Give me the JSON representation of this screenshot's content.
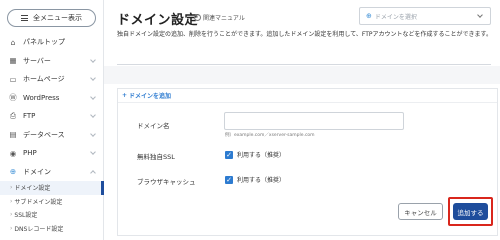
{
  "sidebar": {
    "menu_button_label": "全メニュー表示",
    "items": [
      {
        "icon": "home-icon",
        "glyph": "⌂",
        "label": "パネルトップ",
        "chevron": false
      },
      {
        "icon": "server-icon",
        "glyph": "▦",
        "label": "サーバー",
        "chevron": true
      },
      {
        "icon": "homepage-icon",
        "glyph": "▭",
        "label": "ホームページ",
        "chevron": true
      },
      {
        "icon": "wordpress-icon",
        "glyph": "Ⓦ",
        "label": "WordPress",
        "chevron": true
      },
      {
        "icon": "ftp-icon",
        "glyph": "⎙",
        "label": "FTP",
        "chevron": true
      },
      {
        "icon": "database-icon",
        "glyph": "▤",
        "label": "データベース",
        "chevron": true
      },
      {
        "icon": "php-icon",
        "glyph": "◉",
        "label": "PHP",
        "chevron": true
      },
      {
        "icon": "domain-globe-icon",
        "glyph": "⊕",
        "label": "ドメイン",
        "chevron": true
      }
    ],
    "sub_items": [
      {
        "label": "ドメイン設定",
        "active": true
      },
      {
        "label": "サブドメイン設定",
        "active": false
      },
      {
        "label": "SSL設定",
        "active": false
      },
      {
        "label": "DNSレコード設定",
        "active": false
      }
    ]
  },
  "header": {
    "title": "ドメイン設定",
    "manual_label": "関連マニュアル",
    "domain_select_placeholder": "ドメインを選択",
    "description": "独自ドメイン設定の追加、削除を行うことができます。追加したドメイン設定を利用して、FTPアカウントなどを作成することができます。"
  },
  "form": {
    "section_title": "ドメインを追加",
    "domain_label": "ドメイン名",
    "domain_value": "",
    "domain_hint": "例）example.com／xserver-sample.com",
    "ssl_label": "無料独自SSL",
    "ssl_option": "利用する（推奨）",
    "ssl_checked": true,
    "cache_label": "ブラウザキャッシュ",
    "cache_option": "利用する（推奨）",
    "cache_checked": true,
    "cancel_label": "キャンセル",
    "submit_label": "追加する"
  },
  "colors": {
    "accent": "#1e4d9c",
    "link": "#2d7bd0",
    "highlight": "#d9261c"
  }
}
